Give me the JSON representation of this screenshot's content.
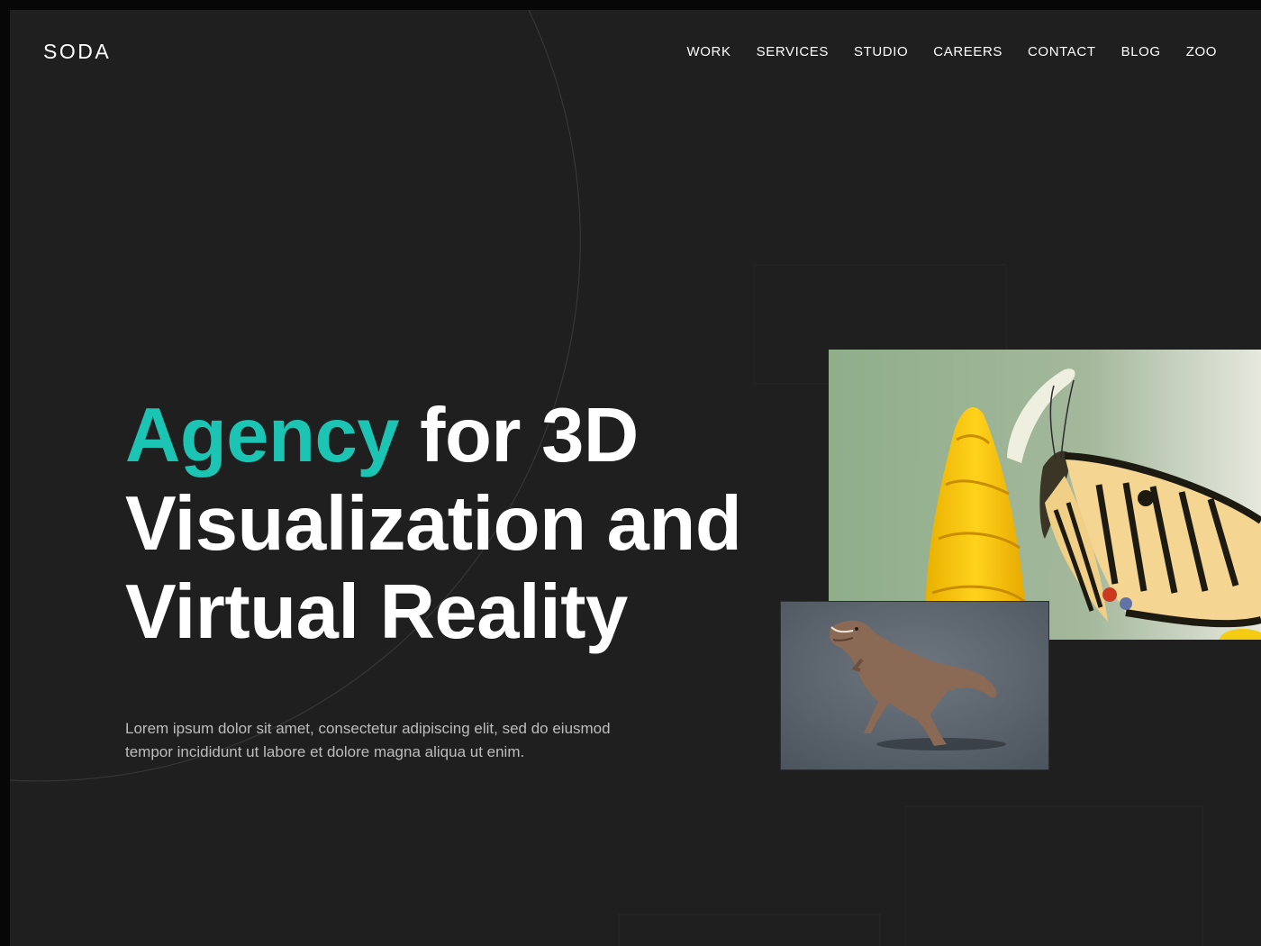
{
  "brand": {
    "logo": "SODA"
  },
  "nav": {
    "items": [
      {
        "label": "WORK"
      },
      {
        "label": "SERVICES"
      },
      {
        "label": "STUDIO"
      },
      {
        "label": "CAREERS"
      },
      {
        "label": "CONTACT"
      },
      {
        "label": "BLOG"
      },
      {
        "label": "ZOO"
      }
    ]
  },
  "hero": {
    "title_accent": "Agency",
    "title_rest_line1": " for 3D",
    "title_line2": "Visualization and",
    "title_line3": "Virtual Reality",
    "description_line1": "Lorem ipsum dolor sit amet, consectetur adipiscing elit, sed do eiusmod",
    "description_line2": "tempor incididunt ut labore et dolore magna aliqua ut enim."
  },
  "colors": {
    "background": "#1f1f1f",
    "accent": "#1cc4b3",
    "text": "#ffffff",
    "muted_text": "#bdbdbd"
  },
  "images": {
    "butterfly": "butterfly-on-yellow-flower-photo",
    "dinosaur": "3d-dinosaur-render"
  }
}
